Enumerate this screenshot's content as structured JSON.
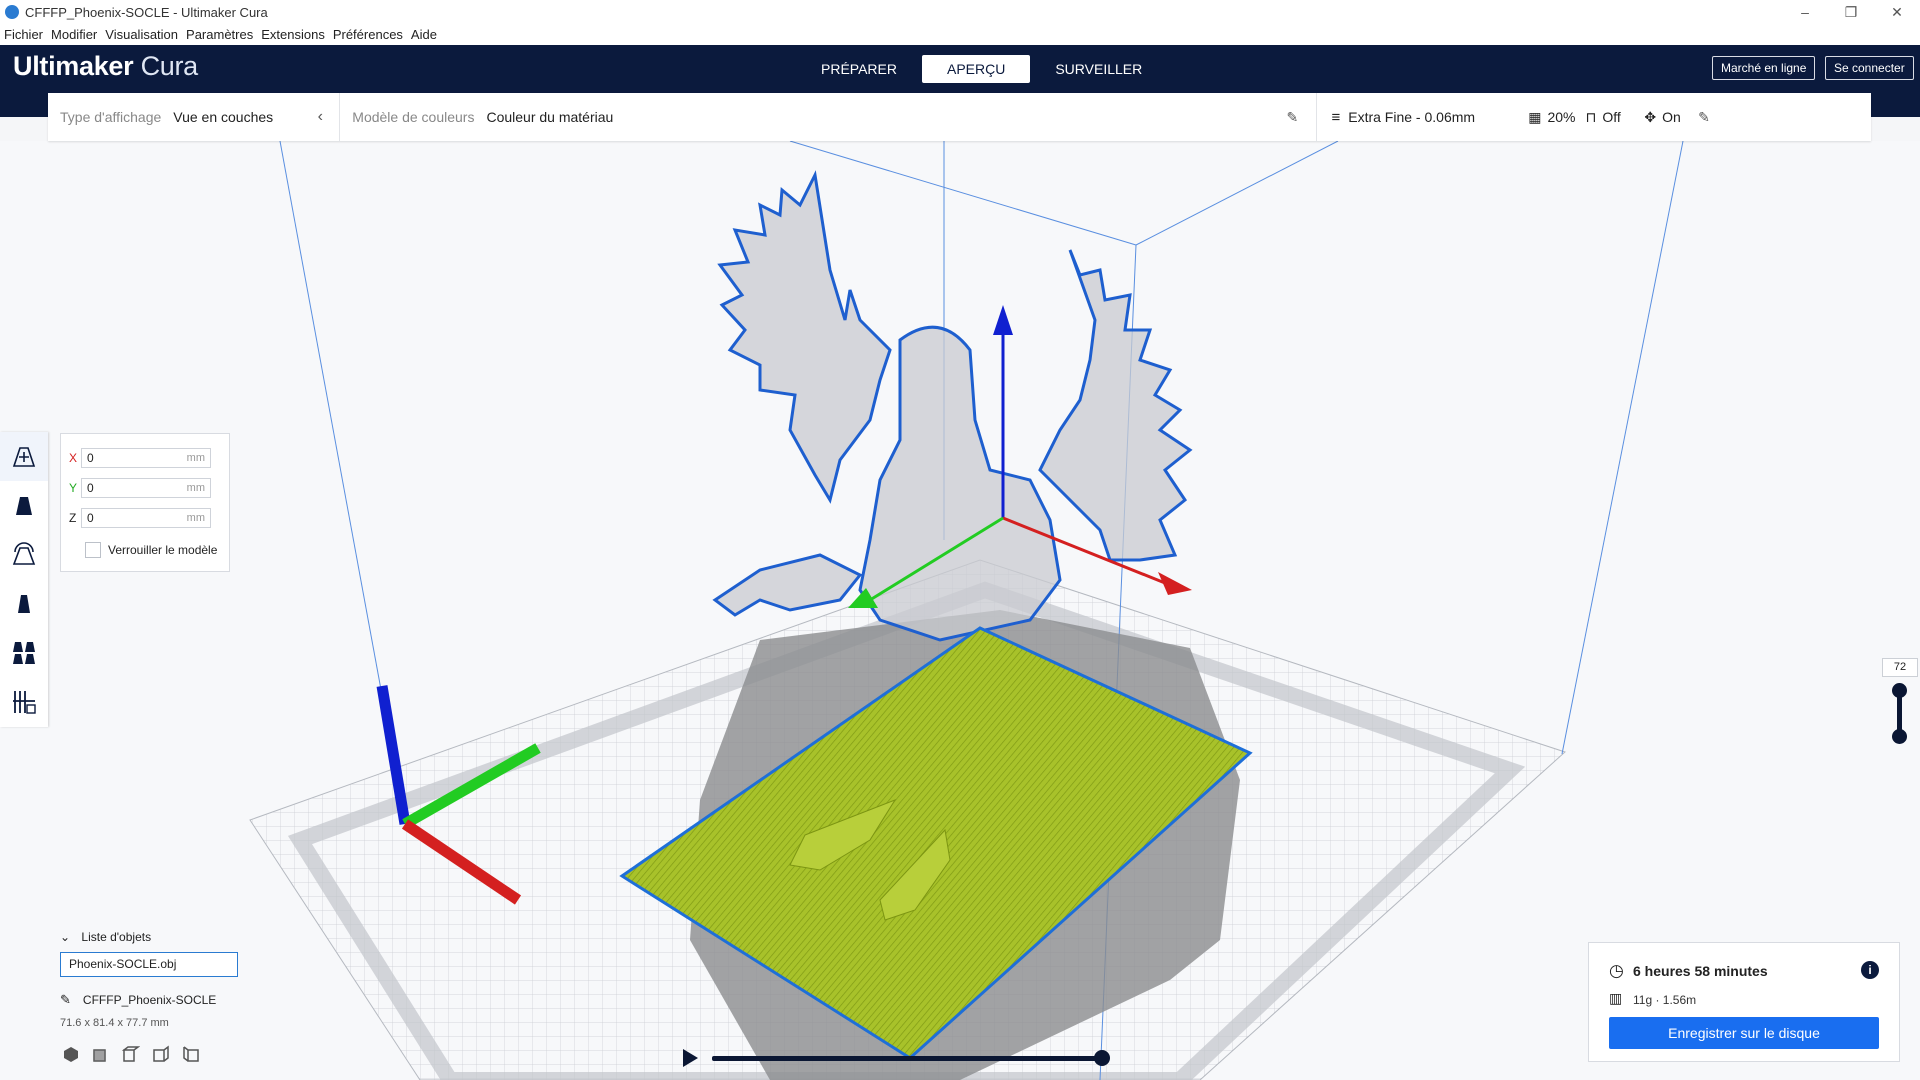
{
  "window": {
    "title": "CFFFP_Phoenix-SOCLE - Ultimaker Cura",
    "minimize": "–",
    "restore": "❐",
    "close": "✕"
  },
  "menu": [
    "Fichier",
    "Modifier",
    "Visualisation",
    "Paramètres",
    "Extensions",
    "Préférences",
    "Aide"
  ],
  "header": {
    "brand_bold": "Ultimaker",
    "brand_light": "Cura",
    "tabs": [
      "PRÉPARER",
      "APERÇU",
      "SURVEILLER"
    ],
    "active_tab": "APERÇU",
    "marketplace": "Marché en ligne",
    "signin": "Se connecter"
  },
  "view_options": {
    "view_type_label": "Type d'affichage",
    "view_type_value": "Vue en couches",
    "color_scheme_label": "Modèle de couleurs",
    "color_scheme_value": "Couleur du matériau",
    "profile": "Extra Fine - 0.06mm",
    "infill": "20%",
    "support": "Off",
    "adhesion": "On"
  },
  "move_panel": {
    "x_label": "X",
    "x_value": "0",
    "y_label": "Y",
    "y_value": "0",
    "z_label": "Z",
    "z_value": "0",
    "unit": "mm",
    "lock_label": "Verrouiller le modèle",
    "lock_checked": false
  },
  "objects": {
    "list_label": "Liste d'objets",
    "file": "Phoenix-SOCLE.obj",
    "job_name": "CFFFP_Phoenix-SOCLE",
    "dimensions": "71.6 x 81.4 x 77.7 mm"
  },
  "print": {
    "time": "6 heures 58 minutes",
    "material": "11g · 1.56m",
    "save_button": "Enregistrer sur le disque"
  },
  "layer": {
    "current": "72"
  },
  "colors": {
    "header": "#0b1a3d",
    "accent": "#196ef0",
    "model_base": "#a9c12a",
    "outline": "#1e5fcf",
    "axis_x": "#d42020",
    "axis_y": "#22cc22",
    "axis_z": "#1020d0"
  }
}
